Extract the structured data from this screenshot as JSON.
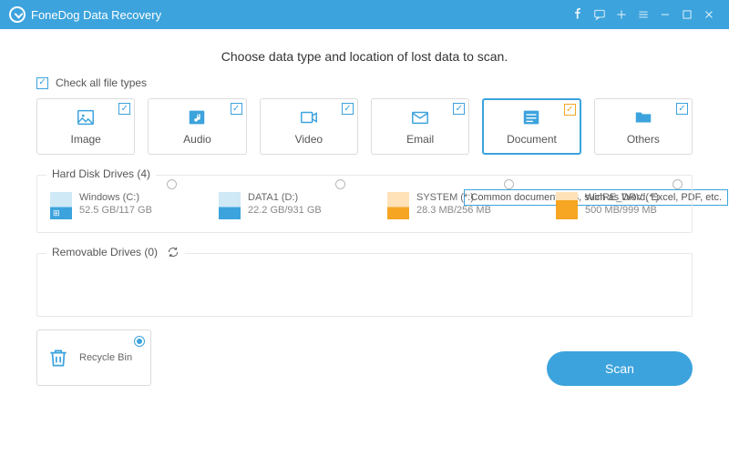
{
  "app": {
    "title": "FoneDog Data Recovery"
  },
  "headline": "Choose data type and location of lost data to scan.",
  "checkall_label": "Check all file types",
  "types": [
    {
      "label": "Image"
    },
    {
      "label": "Audio"
    },
    {
      "label": "Video"
    },
    {
      "label": "Email"
    },
    {
      "label": "Document"
    },
    {
      "label": "Others"
    }
  ],
  "tooltip": "Common document files, such as Word, Excel, PDF, etc.",
  "sections": {
    "hdd_title": "Hard Disk Drives (4)",
    "removable_title": "Removable Drives (0)"
  },
  "drives": [
    {
      "name": "Windows (C:)",
      "size": "52.5 GB/117 GB"
    },
    {
      "name": "DATA1 (D:)",
      "size": "22.2 GB/931 GB"
    },
    {
      "name": "SYSTEM (*:)",
      "size": "28.3 MB/256 MB"
    },
    {
      "name": "WinRE_DRV (*:)",
      "size": "500 MB/999 MB"
    }
  ],
  "recycle_label": "Recycle Bin",
  "scan_label": "Scan"
}
